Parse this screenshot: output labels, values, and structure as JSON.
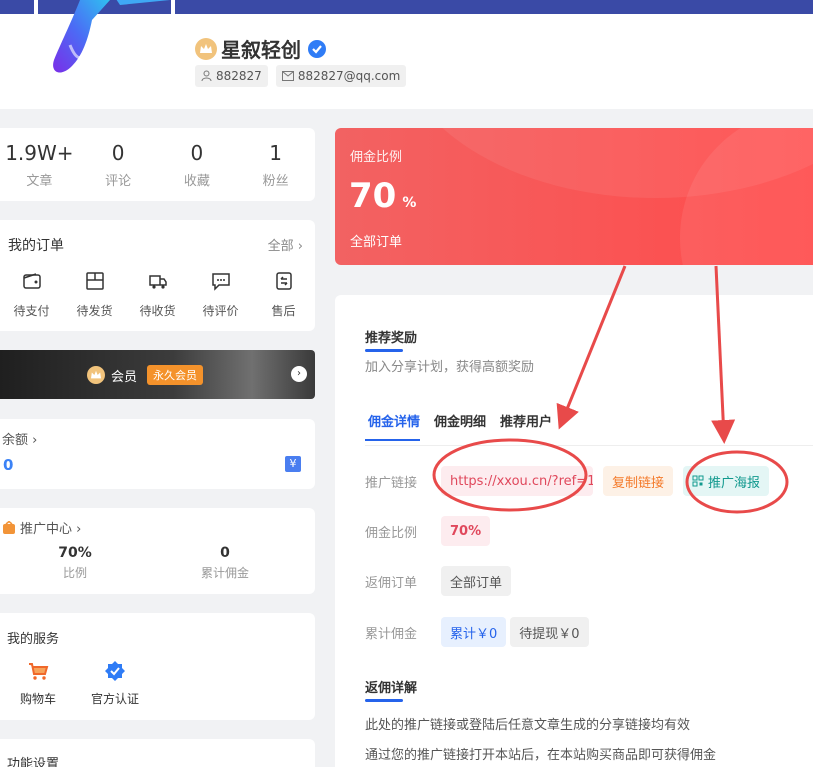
{
  "profile": {
    "username": "星叙轻创",
    "user_id": "882827",
    "email": "882827@qq.com"
  },
  "stats": [
    {
      "value": "1.9W+",
      "label": "文章"
    },
    {
      "value": "0",
      "label": "评论"
    },
    {
      "value": "0",
      "label": "收藏"
    },
    {
      "value": "1",
      "label": "粉丝"
    }
  ],
  "orders": {
    "title": "我的订单",
    "more": "全部 ›",
    "items": [
      {
        "label": "待支付",
        "icon": "wallet-icon"
      },
      {
        "label": "待发货",
        "icon": "package-icon"
      },
      {
        "label": "待收货",
        "icon": "truck-icon"
      },
      {
        "label": "待评价",
        "icon": "comment-icon"
      },
      {
        "label": "售后",
        "icon": "refund-icon"
      }
    ]
  },
  "vip": {
    "label": "会员",
    "badge": "永久会员"
  },
  "balance": {
    "title": "余额 ›",
    "value": "0"
  },
  "promo": {
    "title": "推广中心 ›",
    "rate_value": "70%",
    "rate_label": "比例",
    "total_value": "0",
    "total_label": "累计佣金"
  },
  "services": {
    "title": "我的服务",
    "items": [
      {
        "label": "购物车",
        "icon": "cart-icon"
      },
      {
        "label": "官方认证",
        "icon": "verified-icon"
      }
    ]
  },
  "settings": {
    "title": "功能设置"
  },
  "commission": {
    "title": "佣金比例",
    "value": "70",
    "unit": "%",
    "subtitle": "全部订单"
  },
  "main": {
    "section_title": "推荐奖励",
    "section_subtitle": "加入分享计划，获得高额奖励",
    "tabs": [
      "佣金详情",
      "佣金明细",
      "推荐用户"
    ],
    "rows": {
      "link_label": "推广链接",
      "link_value": "https://xxou.cn/?ref=1",
      "copy_button": "复制链接",
      "poster_button": "推广海报",
      "rate_label": "佣金比例",
      "rate_value": "70%",
      "orders_label": "返佣订单",
      "orders_value": "全部订单",
      "total_label": "累计佣金",
      "total_value": "累计￥0",
      "pending_value": "待提现￥0"
    },
    "detail_title": "返佣详解",
    "detail_lines": [
      "此处的推广链接或登陆后任意文章生成的分享链接均有效",
      "通过您的推广链接打开本站后，在本站购买商品即可获得佣金"
    ]
  },
  "colors": {
    "accent": "#2563eb",
    "commission_red": "#ff4b4b",
    "annotation_red": "#e84a4a"
  }
}
